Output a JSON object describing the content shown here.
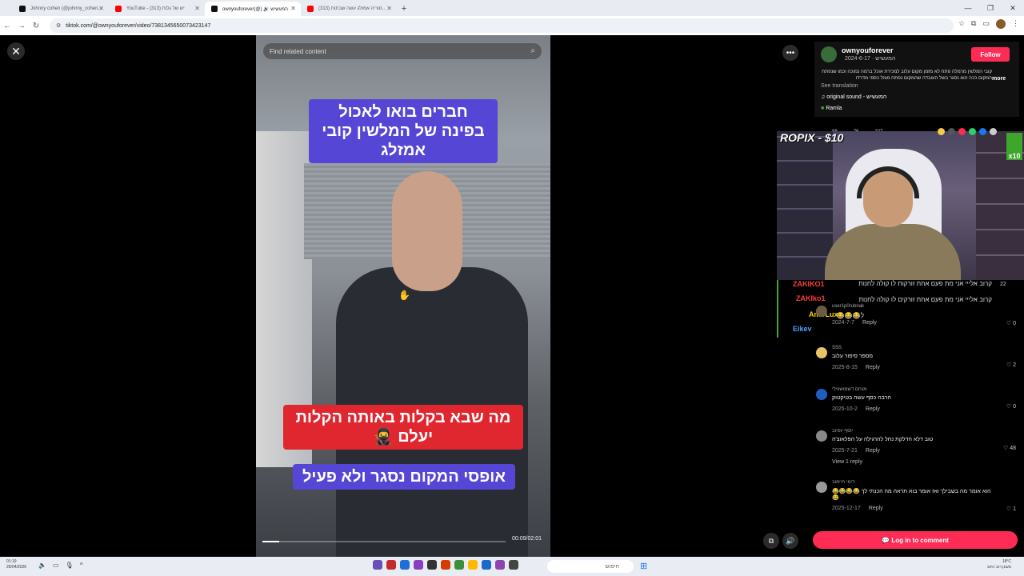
{
  "browser": {
    "tabs": [
      {
        "title": "Johnny cohen (@johnny_cohen...",
        "fav_color": "#111111"
      },
      {
        "title": "YouTube - יש של גלות (313)",
        "fav_color": "#ff0000"
      },
      {
        "title": "ownyouforever(@) 🔊 המעשיש",
        "fav_color": "#111111"
      },
      {
        "title": "(313) סוריה אמזלג עשה שבתות...",
        "fav_color": "#ff0000"
      }
    ],
    "url": "tiktok.com/@ownyouforever/video/7381345650073423147",
    "new_tab": "+",
    "win_min": "—",
    "win_max": "❐",
    "win_close": "✕"
  },
  "video": {
    "search_placeholder": "Find related content",
    "caption_top": "חברים בואו לאכול בפינה של המלשין קובי אמזלג",
    "caption_mid": "מה שבא בקלות באותה הקלות יעלם 🥷",
    "caption_bottom": "אופסי המקום נסגר ולא פעיל",
    "time": "00:09/02:01",
    "progress": 0.07
  },
  "author": {
    "username": "ownyouforever",
    "subtitle": "המעשיש · 2024-6-17",
    "follow_label": "Follow",
    "description": "קובי המלשין מרמלה פתח לא מזמן מקום עלוב למכירת אוכל ברמה נמוכה וכמו שנפתח המקום ככה הוא נסגר בשל העובדה שהמקום נפתח מגזל כספי מדרדו",
    "more_label": "more",
    "see_translation": "See translation",
    "sound": "original sound - המעשיש",
    "location": "Ramla"
  },
  "stats": {
    "a": "88",
    "b": "76",
    "c": "227"
  },
  "stream": {
    "overlay_text": "ROPIX - $10",
    "badge": "x10",
    "chat": [
      {
        "user": "ZAKIKO1",
        "color": "#ff3b3b",
        "text": "קרוב אלייי אני מת פעם אחת זורקות לו קולה לחנות"
      },
      {
        "user": "ZAKIko1",
        "color": "#ff3b3b",
        "text": "קרוב אלייי אני מת פעם אחת זורקים לו קולה לחנות"
      },
      {
        "user": "AmirLux",
        "color": "#ffd400",
        "text": "ל😂😂😂"
      },
      {
        "user": "Eikev",
        "color": "#4aa3ff",
        "text": ""
      }
    ]
  },
  "comments": {
    "top_likes": "22",
    "list": [
      {
        "name": "user1p0rubnak",
        "text": "",
        "date": "2024-7-7",
        "reply": "Reply",
        "likes": "0",
        "avatar": "#6b5a44"
      },
      {
        "name": "SSS",
        "text": "מספר סיפור עלוב",
        "date": "2025-8-15",
        "reply": "Reply",
        "likes": "2",
        "avatar": "#e8c36a"
      },
      {
        "name": "מנחם דשמושווילי",
        "text": "הרבה כסף עשה בטיקטוק",
        "date": "2025-10-2",
        "reply": "Reply",
        "likes": "0",
        "avatar": "#1f5fbf"
      },
      {
        "name": "יוסף יוסיוב",
        "text": "טוב דלא הדלקת נחל להרגילה על הפלאוצ'ה",
        "date": "2025-7-21",
        "reply": "Reply",
        "likes": "48",
        "avatar": "#888888",
        "view_replies": "View 1 reply"
      },
      {
        "name": "דימי חיימוב",
        "text": "הוא אומר מה בשבילך ואז אומר בוא תראה מה הכנתי לך 😂😂😂😂😂",
        "date": "2025-12-17",
        "reply": "Reply",
        "likes": "1",
        "avatar": "#9a9a9a"
      }
    ],
    "login_label": "Log in to comment"
  },
  "taskbar": {
    "time": "01:19",
    "date": "26/04/2026",
    "search_placeholder": "חיפוש",
    "weather": "18°C",
    "weather_sub": "מעונן רוב היום",
    "app_colors": [
      "#6a4fb8",
      "#c22c2c",
      "#1e6fd9",
      "#8a3fc0",
      "#333333",
      "#d83b01",
      "#3a8f3a",
      "#ffb900",
      "#1b6ac9",
      "#8e44ad",
      "#444444"
    ]
  }
}
